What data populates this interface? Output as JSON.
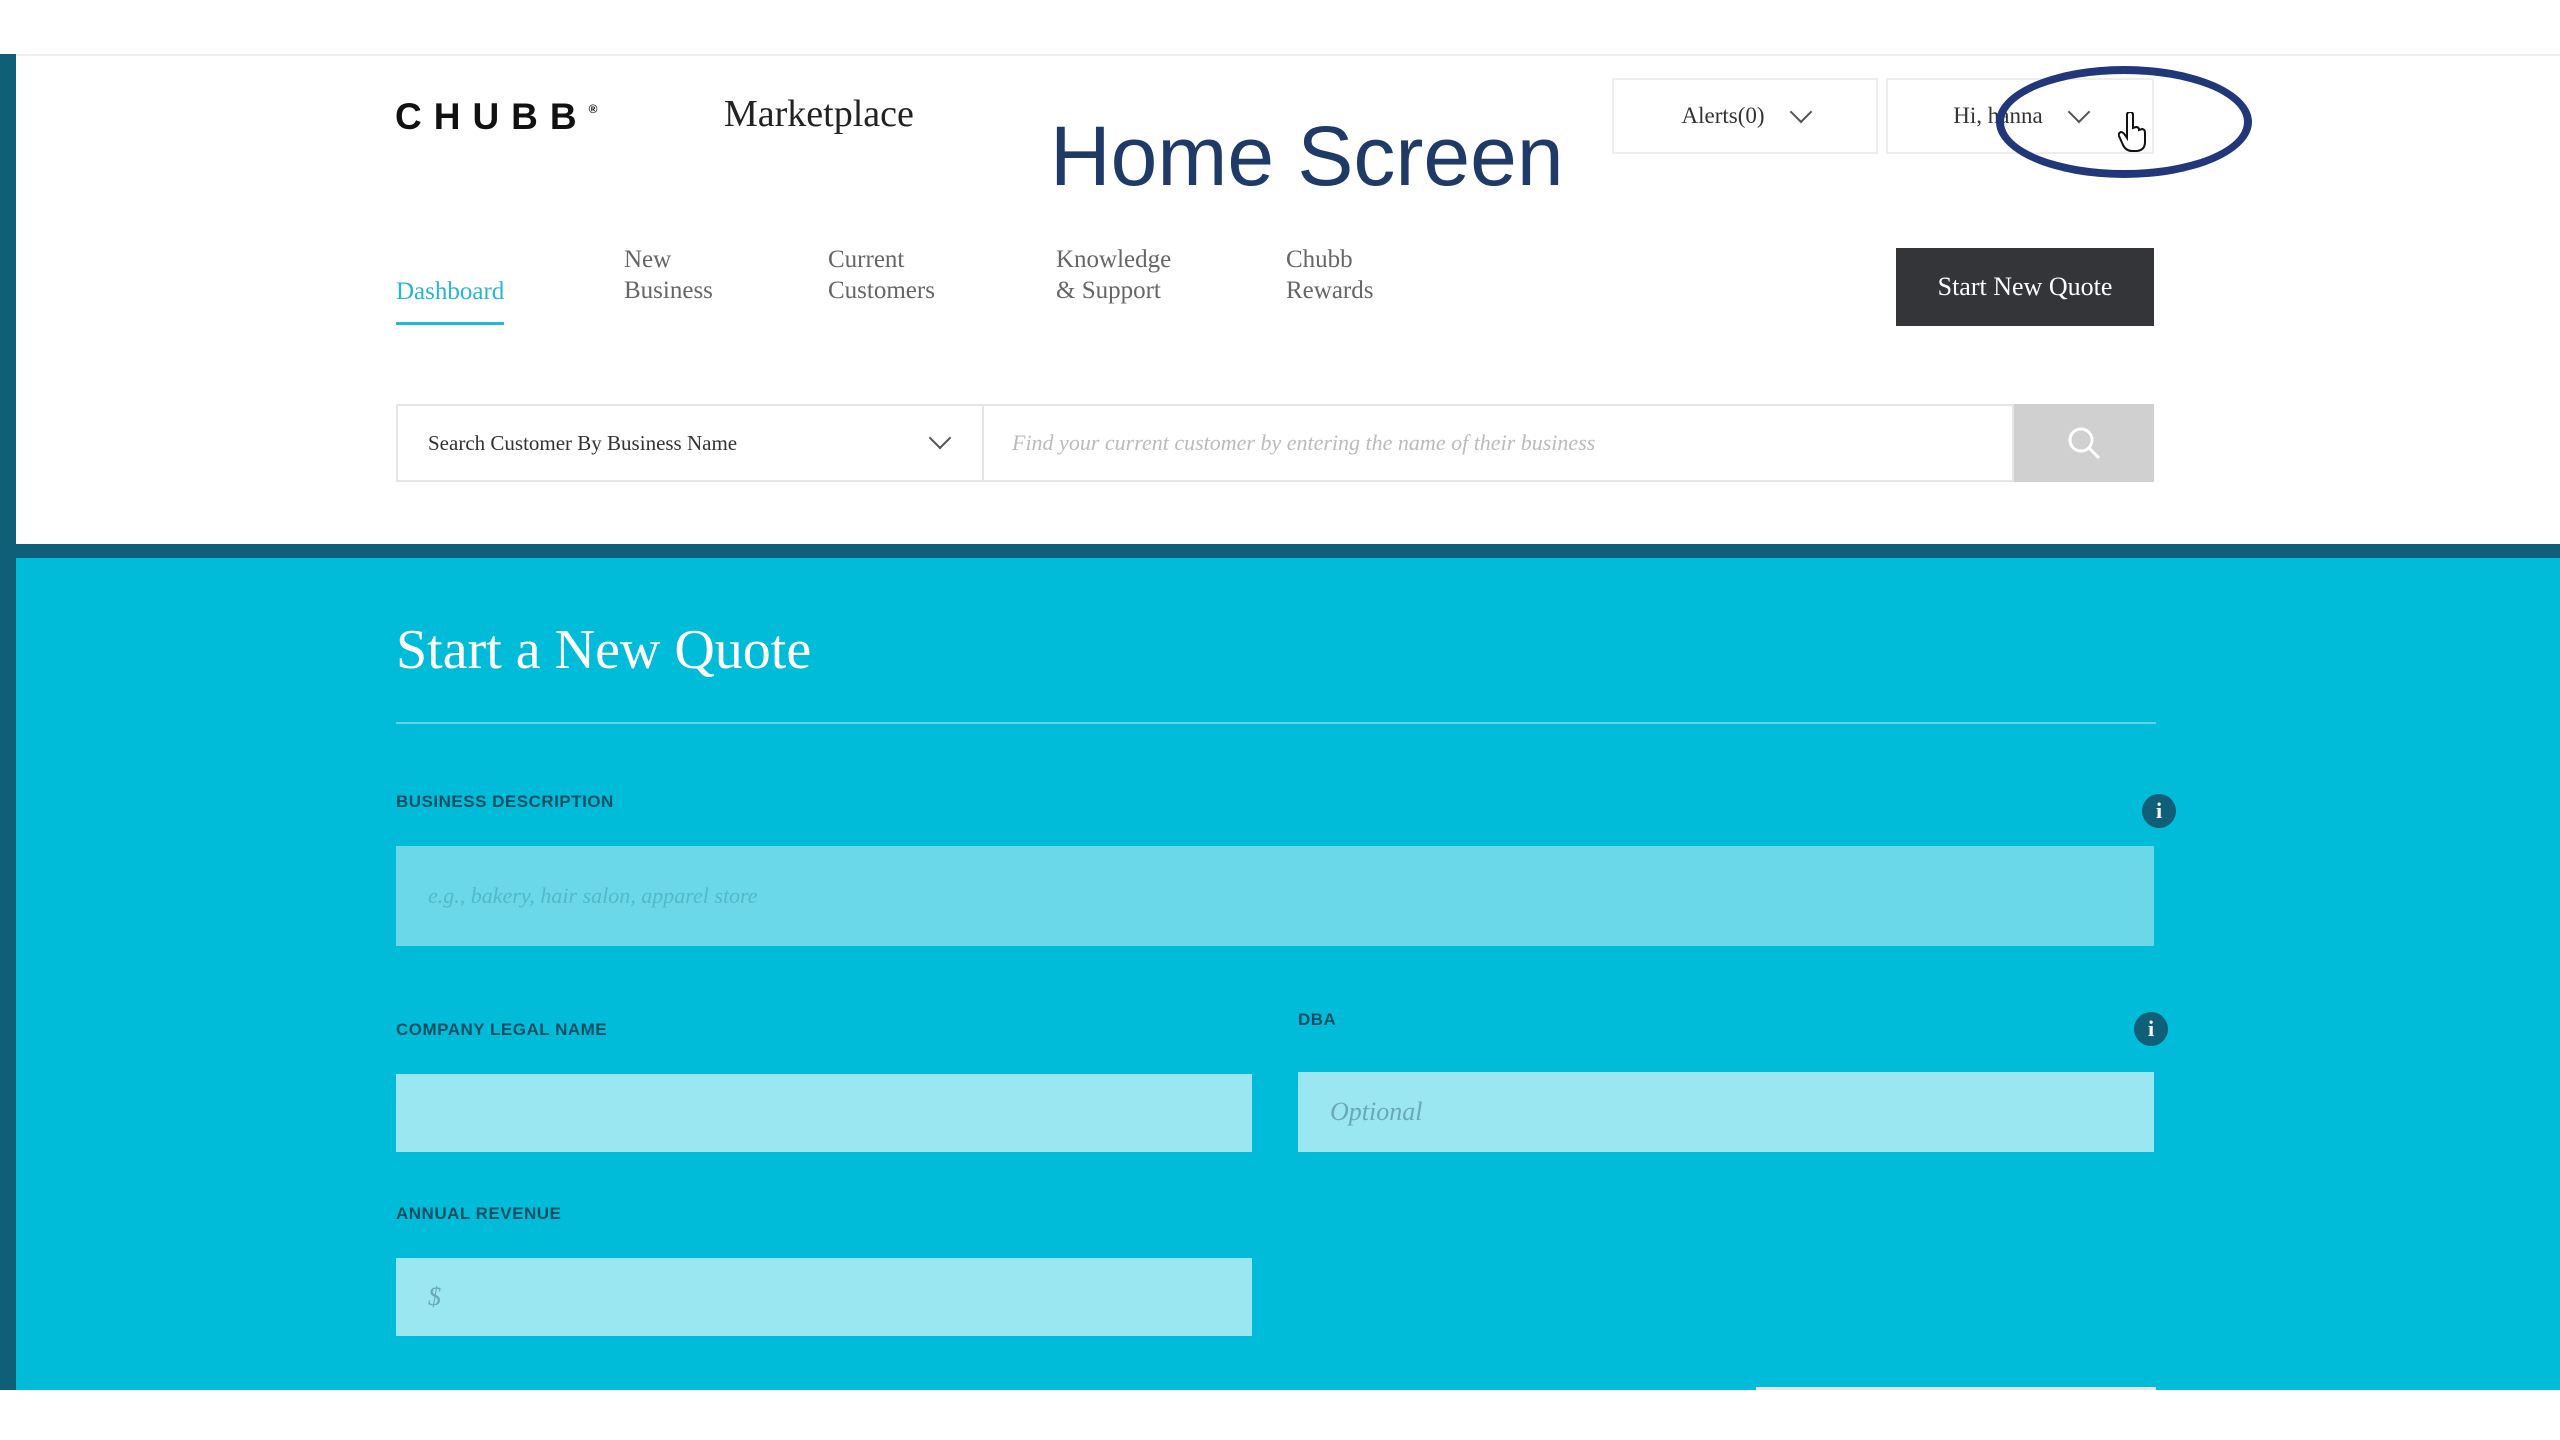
{
  "header": {
    "logo_text": "CHUBB",
    "logo_mark": "®",
    "app_name": "Marketplace",
    "overlay_title": "Home Screen",
    "alerts_label": "Alerts(0)",
    "greeting": "Hi, hanna"
  },
  "nav": {
    "items": [
      {
        "label": "Dashboard",
        "active": true
      },
      {
        "label": "New\nBusiness",
        "active": false
      },
      {
        "label": "Current\nCustomers",
        "active": false
      },
      {
        "label": "Knowledge\n& Support",
        "active": false
      },
      {
        "label": "Chubb\nRewards",
        "active": false
      }
    ],
    "start_quote_label": "Start New Quote"
  },
  "search": {
    "type_selected": "Search Customer By Business Name",
    "placeholder": "Find your current customer by entering the name of their business",
    "icon": "search-icon"
  },
  "quote": {
    "title": "Start a New Quote",
    "business_description": {
      "label": "BUSINESS DESCRIPTION",
      "placeholder": "e.g., bakery, hair salon, apparel store"
    },
    "company_legal_name": {
      "label": "COMPANY LEGAL NAME",
      "placeholder": ""
    },
    "dba": {
      "label": "DBA",
      "placeholder": "Optional"
    },
    "annual_revenue": {
      "label": "ANNUAL REVENUE",
      "placeholder": "$"
    },
    "info_glyph": "i"
  },
  "colors": {
    "brand_teal": "#00bcd8",
    "dark_teal": "#0f5f78",
    "nav_active": "#27b6d0",
    "button_dark": "#333538",
    "annotation_blue": "#22377a"
  }
}
